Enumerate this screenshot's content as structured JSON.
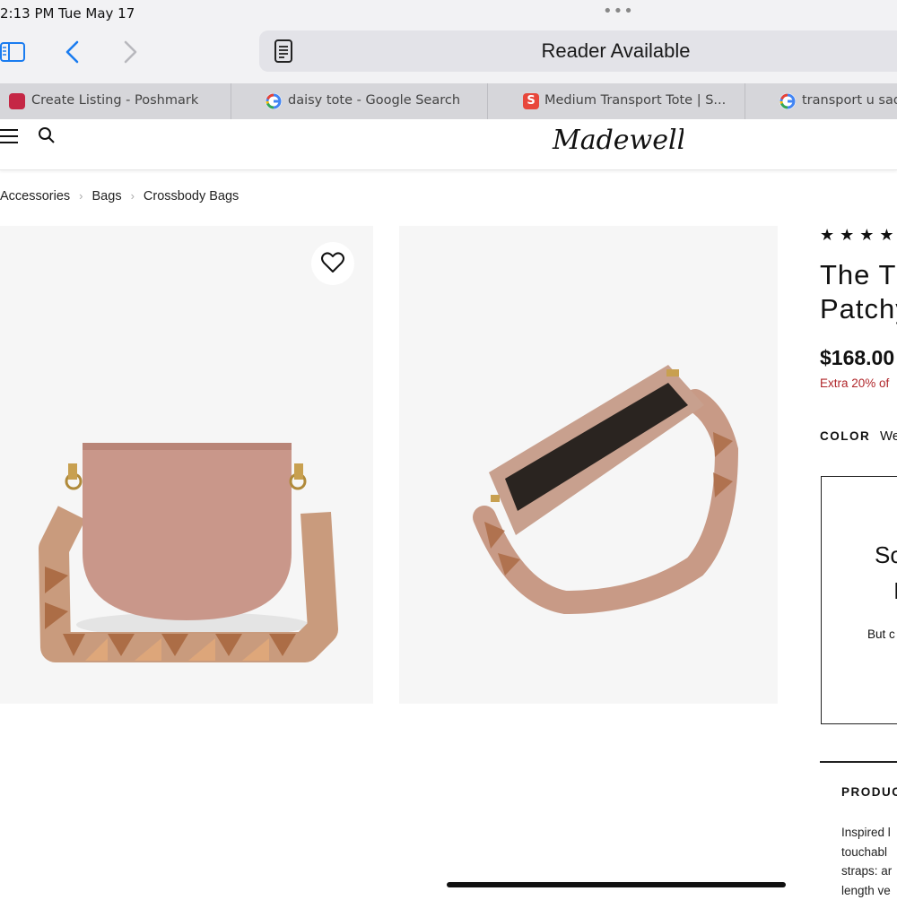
{
  "status_bar": {
    "time": "2:13 PM",
    "date": "Tue May 17"
  },
  "browser": {
    "address_text": "Reader Available",
    "tabs": [
      {
        "label": "Create Listing - Poshmark"
      },
      {
        "label": "daisy tote - Google Search"
      },
      {
        "label": "Medium Transport Tote | S..."
      },
      {
        "label": "transport u sad"
      }
    ]
  },
  "site": {
    "logo_text": "Madewell"
  },
  "breadcrumb": [
    "Accessories",
    "Bags",
    "Crossbody Bags"
  ],
  "product": {
    "rating_stars": "★★★★",
    "title_lines": [
      "The T",
      "Patchy"
    ],
    "price": "$168.00",
    "promo": "Extra 20% of",
    "color_label": "COLOR",
    "color_value": "We",
    "sold_box": [
      "So",
      "I",
      "But c"
    ],
    "details_heading": "PRODUC",
    "details_lines": [
      "Inspired l",
      "touchabl",
      "straps: ar",
      "length ve"
    ]
  },
  "colors": {
    "promo_red": "#b0262a",
    "safari_blue": "#1a7cf0",
    "bag_tan": "#c8a08e"
  },
  "icons": [
    "sidebar-icon",
    "back-icon",
    "forward-icon",
    "reader-icon",
    "menu-icon",
    "search-icon",
    "heart-icon"
  ]
}
